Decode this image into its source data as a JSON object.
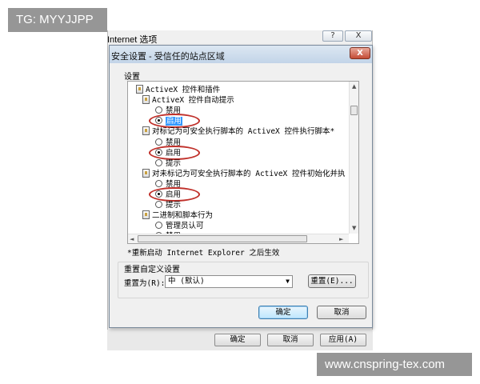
{
  "watermarks": {
    "top_left": "TG: MYYJJPP",
    "bottom_right": "www.cnspring-tex.com"
  },
  "parent_dialog": {
    "title": "Internet 选项",
    "help_button": "?",
    "close_button": "X",
    "buttons": [
      "确定",
      "取消",
      "应用(A)"
    ]
  },
  "dialog": {
    "title": "安全设置 - 受信任的站点区域",
    "close_button": "X",
    "settings_label": "设置",
    "tree": [
      {
        "kind": "group",
        "label": "ActiveX 控件和插件",
        "indent": 0
      },
      {
        "kind": "group",
        "label": "ActiveX 控件自动提示",
        "indent": 1
      },
      {
        "kind": "radio",
        "label": "禁用",
        "checked": false,
        "indent": 2
      },
      {
        "kind": "radio",
        "label": "启用",
        "checked": true,
        "selected": true,
        "circled": true,
        "indent": 2
      },
      {
        "kind": "group",
        "label": "对标记为可安全执行脚本的 ActiveX 控件执行脚本*",
        "indent": 1
      },
      {
        "kind": "radio",
        "label": "禁用",
        "checked": false,
        "indent": 2
      },
      {
        "kind": "radio",
        "label": "启用",
        "checked": true,
        "circled": true,
        "indent": 2
      },
      {
        "kind": "radio",
        "label": "提示",
        "checked": false,
        "indent": 2
      },
      {
        "kind": "group",
        "label": "对未标记为可安全执行脚本的 ActiveX 控件初始化并执",
        "indent": 1
      },
      {
        "kind": "radio",
        "label": "禁用",
        "checked": false,
        "indent": 2
      },
      {
        "kind": "radio",
        "label": "启用",
        "checked": true,
        "circled": true,
        "indent": 2
      },
      {
        "kind": "radio",
        "label": "提示",
        "checked": false,
        "indent": 2
      },
      {
        "kind": "group",
        "label": "二进制和脚本行为",
        "indent": 1
      },
      {
        "kind": "radio",
        "label": "管理员认可",
        "checked": false,
        "indent": 2
      },
      {
        "kind": "radio",
        "label": "禁用",
        "checked": false,
        "indent": 2
      }
    ],
    "restart_note": "*重新启动 Internet Explorer 之后生效",
    "custom_title": "重置自定义设置",
    "reset_to_label": "重置为(R):",
    "reset_to_value": "中 (默认)",
    "reset_button": "重置(E)...",
    "ok_button": "确定",
    "cancel_button": "取消",
    "highlight_color": "#c0302a",
    "selection_color": "#3399ff"
  }
}
